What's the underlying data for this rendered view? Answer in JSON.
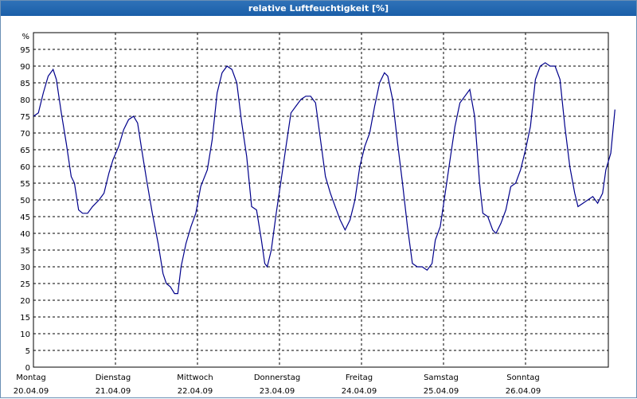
{
  "window": {
    "title": "relative Luftfeuchtigkeit [%]"
  },
  "chart_data": {
    "type": "line",
    "title": "relative Luftfeuchtigkeit [%]",
    "ylabel": "%",
    "xlabel": "",
    "ylim": [
      0,
      100
    ],
    "xlim": [
      0,
      7
    ],
    "grid": true,
    "y_ticks": [
      "0",
      "5",
      "10",
      "15",
      "20",
      "25",
      "30",
      "35",
      "40",
      "45",
      "50",
      "55",
      "60",
      "65",
      "70",
      "75",
      "80",
      "85",
      "90",
      "95"
    ],
    "x_ticks": [
      {
        "x": 0,
        "day": "Montag",
        "date": "20.04.09"
      },
      {
        "x": 1,
        "day": "Dienstag",
        "date": "21.04.09"
      },
      {
        "x": 2,
        "day": "Mittwoch",
        "date": "22.04.09"
      },
      {
        "x": 3,
        "day": "Donnerstag",
        "date": "23.04.09"
      },
      {
        "x": 4,
        "day": "Freitag",
        "date": "24.04.09"
      },
      {
        "x": 5,
        "day": "Samstag",
        "date": "25.04.09"
      },
      {
        "x": 6,
        "day": "Sonntag",
        "date": "26.04.09"
      }
    ],
    "colors": {
      "line": "#00008b",
      "grid": "#000000"
    },
    "series": [
      {
        "values": [
          [
            0.0,
            75
          ],
          [
            0.06,
            76
          ],
          [
            0.12,
            82
          ],
          [
            0.18,
            87
          ],
          [
            0.24,
            89
          ],
          [
            0.28,
            86
          ],
          [
            0.34,
            76
          ],
          [
            0.4,
            67
          ],
          [
            0.46,
            57
          ],
          [
            0.5,
            55
          ],
          [
            0.55,
            47
          ],
          [
            0.6,
            46
          ],
          [
            0.66,
            46
          ],
          [
            0.72,
            48
          ],
          [
            0.8,
            50
          ],
          [
            0.86,
            52
          ],
          [
            0.92,
            58
          ],
          [
            0.97,
            62
          ],
          [
            1.04,
            66
          ],
          [
            1.1,
            71
          ],
          [
            1.16,
            74
          ],
          [
            1.22,
            75
          ],
          [
            1.27,
            73
          ],
          [
            1.32,
            65
          ],
          [
            1.38,
            56
          ],
          [
            1.45,
            46
          ],
          [
            1.52,
            37
          ],
          [
            1.58,
            28
          ],
          [
            1.62,
            25
          ],
          [
            1.67,
            24
          ],
          [
            1.72,
            22
          ],
          [
            1.76,
            22
          ],
          [
            1.8,
            30
          ],
          [
            1.86,
            37
          ],
          [
            1.92,
            42
          ],
          [
            1.98,
            46
          ],
          [
            2.04,
            54
          ],
          [
            2.12,
            59
          ],
          [
            2.18,
            68
          ],
          [
            2.24,
            82
          ],
          [
            2.3,
            88
          ],
          [
            2.36,
            90
          ],
          [
            2.42,
            89
          ],
          [
            2.48,
            85
          ],
          [
            2.54,
            73
          ],
          [
            2.6,
            63
          ],
          [
            2.66,
            48
          ],
          [
            2.72,
            47
          ],
          [
            2.78,
            38
          ],
          [
            2.82,
            31
          ],
          [
            2.85,
            30
          ],
          [
            2.9,
            35
          ],
          [
            2.96,
            46
          ],
          [
            3.02,
            56
          ],
          [
            3.08,
            66
          ],
          [
            3.14,
            76
          ],
          [
            3.2,
            78
          ],
          [
            3.26,
            80
          ],
          [
            3.32,
            81
          ],
          [
            3.38,
            81
          ],
          [
            3.44,
            79
          ],
          [
            3.5,
            68
          ],
          [
            3.56,
            57
          ],
          [
            3.62,
            52
          ],
          [
            3.68,
            48
          ],
          [
            3.74,
            44
          ],
          [
            3.8,
            41
          ],
          [
            3.86,
            44
          ],
          [
            3.92,
            50
          ],
          [
            3.98,
            60
          ],
          [
            4.04,
            66
          ],
          [
            4.1,
            70
          ],
          [
            4.16,
            78
          ],
          [
            4.22,
            85
          ],
          [
            4.28,
            88
          ],
          [
            4.32,
            87
          ],
          [
            4.38,
            80
          ],
          [
            4.44,
            67
          ],
          [
            4.5,
            55
          ],
          [
            4.56,
            42
          ],
          [
            4.62,
            31
          ],
          [
            4.68,
            30
          ],
          [
            4.74,
            30
          ],
          [
            4.8,
            29
          ],
          [
            4.86,
            31
          ],
          [
            4.9,
            38
          ],
          [
            4.96,
            42
          ],
          [
            5.02,
            52
          ],
          [
            5.08,
            62
          ],
          [
            5.14,
            72
          ],
          [
            5.2,
            79
          ],
          [
            5.26,
            81
          ],
          [
            5.32,
            83
          ],
          [
            5.38,
            75
          ],
          [
            5.44,
            55
          ],
          [
            5.48,
            46
          ],
          [
            5.54,
            45
          ],
          [
            5.6,
            41
          ],
          [
            5.64,
            40
          ],
          [
            5.7,
            43
          ],
          [
            5.76,
            47
          ],
          [
            5.82,
            54
          ],
          [
            5.88,
            55
          ],
          [
            5.94,
            59
          ],
          [
            6.0,
            65
          ],
          [
            6.06,
            72
          ],
          [
            6.12,
            86
          ],
          [
            6.18,
            90
          ],
          [
            6.24,
            91
          ],
          [
            6.3,
            90
          ],
          [
            6.36,
            90
          ],
          [
            6.42,
            86
          ],
          [
            6.48,
            72
          ],
          [
            6.54,
            60
          ],
          [
            6.6,
            52
          ],
          [
            6.64,
            48
          ],
          [
            6.7,
            49
          ],
          [
            6.76,
            50
          ],
          [
            6.82,
            51
          ],
          [
            6.88,
            49
          ],
          [
            6.94,
            52
          ],
          [
            6.98,
            59
          ],
          [
            7.04,
            64
          ],
          [
            7.09,
            77
          ]
        ]
      }
    ]
  }
}
